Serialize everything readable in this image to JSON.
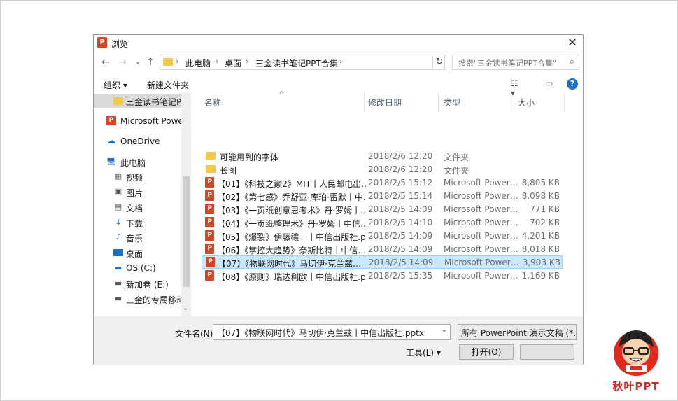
{
  "dialog": {
    "title": "浏览"
  },
  "address": {
    "crumbs": [
      "此电脑",
      "桌面",
      "三金读书笔记PPT合集"
    ],
    "search_placeholder": "搜索\"三金读书笔记PPT合集\""
  },
  "toolbar": {
    "organize": "组织 ▾",
    "new_folder": "新建文件夹"
  },
  "nav": {
    "items": [
      {
        "label": "三金读书笔记PPT合集",
        "icon": "folder-icon"
      },
      {
        "label": "Microsoft PowerPoint",
        "icon": "powerpoint-icon"
      },
      {
        "label": "OneDrive",
        "icon": "onedrive-icon"
      },
      {
        "label": "此电脑",
        "icon": "computer-icon"
      },
      {
        "label": "视频",
        "icon": "video-icon"
      },
      {
        "label": "图片",
        "icon": "pictures-icon"
      },
      {
        "label": "文档",
        "icon": "documents-icon"
      },
      {
        "label": "下载",
        "icon": "download-icon"
      },
      {
        "label": "音乐",
        "icon": "music-icon"
      },
      {
        "label": "桌面",
        "icon": "desktop-icon"
      },
      {
        "label": "OS (C:)",
        "icon": "drive-icon"
      },
      {
        "label": "新加卷 (E:)",
        "icon": "drive-icon"
      },
      {
        "label": "三金的专属移动硬盘",
        "icon": "usb-drive-icon"
      }
    ]
  },
  "files": {
    "columns": [
      "名称",
      "修改日期",
      "类型",
      "大小"
    ],
    "rows": [
      {
        "name": "可能用到的字体",
        "date": "2018/2/6 12:20",
        "type": "文件夹",
        "size": "",
        "icon": "folder-icon"
      },
      {
        "name": "长图",
        "date": "2018/2/6 12:20",
        "type": "文件夹",
        "size": "",
        "icon": "folder-icon"
      },
      {
        "name": "【01】《科技之巅2》MIT丨人民邮电出…",
        "date": "2018/2/5 15:12",
        "type": "Microsoft Power…",
        "size": "8,805 KB",
        "icon": "ppt-icon"
      },
      {
        "name": "【02】《第七感》乔舒亚·库珀·雷默丨中…",
        "date": "2018/2/5 15:14",
        "type": "Microsoft Power…",
        "size": "8,098 KB",
        "icon": "ppt-icon"
      },
      {
        "name": "【03】《一页纸创意思考术》丹·罗姆丨…",
        "date": "2018/2/5 14:09",
        "type": "Microsoft Power…",
        "size": "771 KB",
        "icon": "ppt-icon"
      },
      {
        "name": "【04】《一页纸整理术》丹·罗姆丨中信…",
        "date": "2018/2/5 14:10",
        "type": "Microsoft Power…",
        "size": "702 KB",
        "icon": "ppt-icon"
      },
      {
        "name": "【05】《爆裂》伊藤穰一丨中信出版社.p…",
        "date": "2018/2/5 14:09",
        "type": "Microsoft Power…",
        "size": "4,201 KB",
        "icon": "ppt-icon"
      },
      {
        "name": "【06】《掌控大趋势》奈斯比特丨中信…",
        "date": "2018/2/5 14:09",
        "type": "Microsoft Power…",
        "size": "8,018 KB",
        "icon": "ppt-icon"
      },
      {
        "name": "【07】《物联网时代》马切伊·克兰兹…",
        "date": "2018/2/5 14:09",
        "type": "Microsoft Power…",
        "size": "3,903 KB",
        "icon": "ppt-icon"
      },
      {
        "name": "【08】《原则》瑞达利欧丨中信出版社.p…",
        "date": "2018/2/5 15:35",
        "type": "Microsoft Power…",
        "size": "1,169 KB",
        "icon": "ppt-icon"
      }
    ]
  },
  "footer": {
    "filename_label": "文件名(N):",
    "filename_value": "【07】《物联网时代》马切伊·克兰兹丨中信出版社.pptx",
    "filetype_value": "所有 PowerPoint 演示文稿 (*.p",
    "tools_label": "工具(L)   ▾",
    "open_label": "打开(O)"
  },
  "watermark": {
    "text": "秋叶PPT"
  }
}
